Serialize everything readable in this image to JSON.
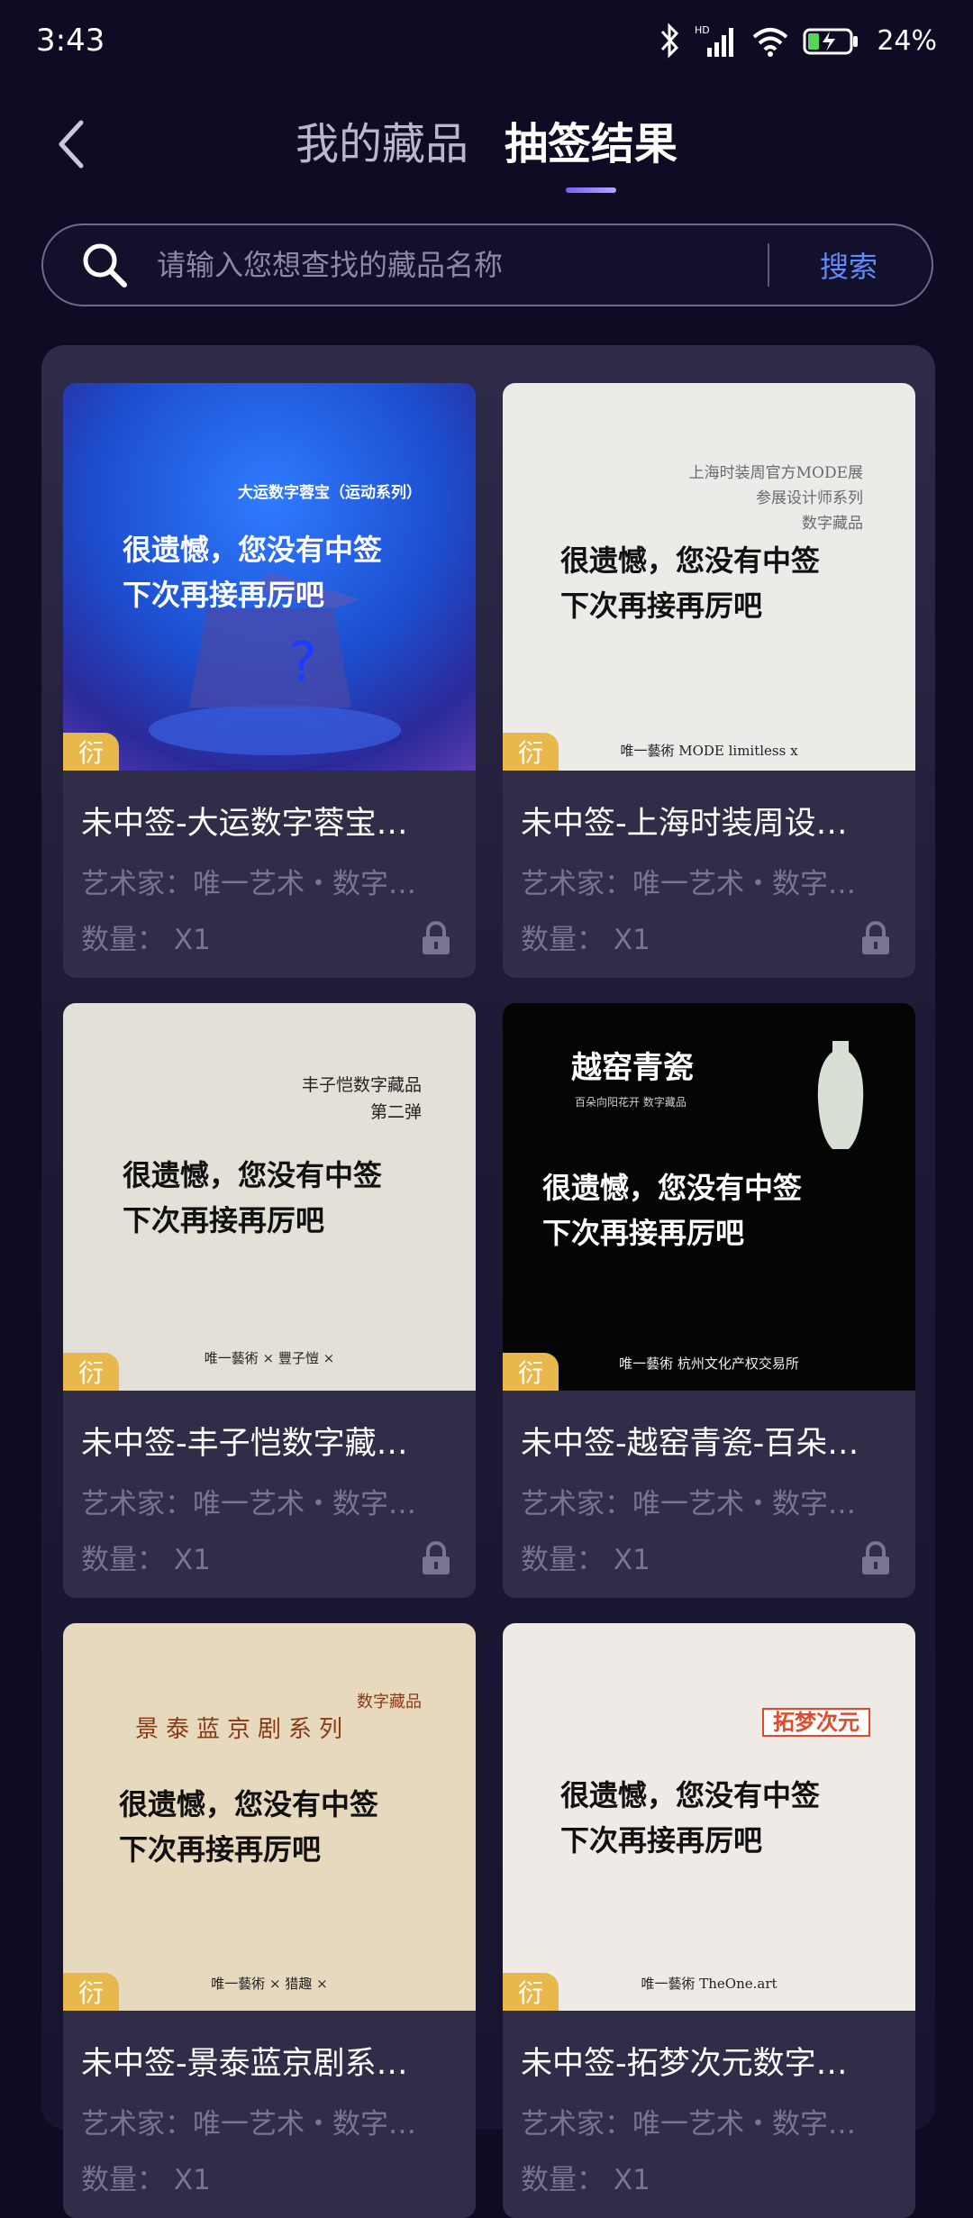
{
  "status": {
    "time": "3:43",
    "battery": "24%"
  },
  "header": {
    "tabs": [
      {
        "label": "我的藏品",
        "active": false
      },
      {
        "label": "抽签结果",
        "active": true
      }
    ]
  },
  "search": {
    "placeholder": "请输入您想查找的藏品名称",
    "button": "搜索"
  },
  "cards": [
    {
      "title": "未中签-大运数字蓉宝…",
      "artist": "艺术家：唯一艺术・数字…",
      "qty": "数量：  X1",
      "badge": "衍",
      "image": {
        "header": "大运数字蓉宝（运动系列）",
        "line1": "很遗憾，您没有中签",
        "line2": "下次再接再厉吧"
      }
    },
    {
      "title": "未中签-上海时装周设…",
      "artist": "艺术家：唯一艺术・数字…",
      "qty": "数量：  X1",
      "badge": "衍",
      "image": {
        "header1": "上海时装周官方MODE展",
        "header2": "参展设计师系列",
        "header3": "数字藏品",
        "line1": "很遗憾，您没有中签",
        "line2": "下次再接再厉吧",
        "footer": "唯一藝術   MODE   limitless x"
      }
    },
    {
      "title": "未中签-丰子恺数字藏…",
      "artist": "艺术家：唯一艺术・数字…",
      "qty": "数量：  X1",
      "badge": "衍",
      "image": {
        "header1": "丰子恺数字藏品",
        "header2": "第二弹",
        "line1": "很遗憾，您没有中签",
        "line2": "下次再接再厉吧",
        "footer": "唯一藝術 × 豐子愷 ×"
      }
    },
    {
      "title": "未中签-越窑青瓷-百朵…",
      "artist": "艺术家：唯一艺术・数字…",
      "qty": "数量：  X1",
      "badge": "衍",
      "image": {
        "header1": "越窑青瓷",
        "header2": "百朵向阳花开 数字藏品",
        "line1": "很遗憾，您没有中签",
        "line2": "下次再接再厉吧",
        "footer": "唯一藝術   杭州文化产权交易所"
      }
    },
    {
      "title": "未中签-景泰蓝京剧系…",
      "artist": "艺术家：唯一艺术・数字…",
      "qty": "数量：  X1",
      "badge": "衍",
      "image": {
        "header1": "数字藏品",
        "header2": "景泰蓝京剧系列",
        "line1": "很遗憾，您没有中签",
        "line2": "下次再接再厉吧",
        "footer": "唯一藝術 × 猎趣 ×"
      }
    },
    {
      "title": "未中签-拓梦次元数字…",
      "artist": "艺术家：唯一艺术・数字…",
      "qty": "数量：  X1",
      "badge": "衍",
      "image": {
        "header1": "拓梦次元",
        "line1": "很遗憾，您没有中签",
        "line2": "下次再接再厉吧",
        "footer": "唯一藝術   TheOne.art"
      }
    }
  ]
}
